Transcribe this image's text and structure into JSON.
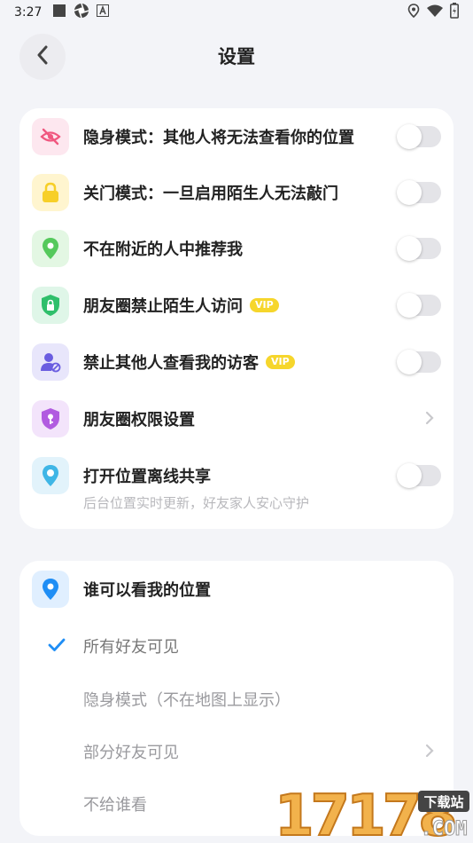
{
  "status_bar": {
    "time": "3:27"
  },
  "header": {
    "title": "设置"
  },
  "privacy": {
    "items": [
      {
        "label": "隐身模式：其他人将无法查看你的位置",
        "icon": "eye-off-icon",
        "icon_bg": "#fde7ef",
        "icon_color": "#f0577f",
        "control": "toggle",
        "on": false
      },
      {
        "label": "关门模式：一旦启用陌生人无法敲门",
        "icon": "lock-icon",
        "icon_bg": "#fff5cf",
        "icon_color": "#f7cf28",
        "control": "toggle",
        "on": false
      },
      {
        "label": "不在附近的人中推荐我",
        "icon": "location-pin-icon",
        "icon_bg": "#e3f7e3",
        "icon_color": "#55c95c",
        "control": "toggle",
        "on": false
      },
      {
        "label": "朋友圈禁止陌生人访问",
        "icon": "shield-lock-icon",
        "icon_bg": "#dff6e8",
        "icon_color": "#2fbf6b",
        "control": "toggle",
        "on": false,
        "badge": "VIP"
      },
      {
        "label": "禁止其他人查看我的访客",
        "icon": "user-block-icon",
        "icon_bg": "#e8e6fb",
        "icon_color": "#6a5de0",
        "control": "toggle",
        "on": false,
        "badge": "VIP"
      },
      {
        "label": "朋友圈权限设置",
        "icon": "shield-key-icon",
        "icon_bg": "#f3e4fb",
        "icon_color": "#b15be0",
        "control": "chevron"
      },
      {
        "label": "打开位置离线共享",
        "icon": "location-share-icon",
        "icon_bg": "#e2f3fb",
        "icon_color": "#3fb6e6",
        "control": "toggle",
        "on": false
      }
    ],
    "offline_share_note": "后台位置实时更新，好友家人安心守护"
  },
  "visibility": {
    "title": "谁可以看我的位置",
    "icon": "location-pin-icon",
    "icon_bg": "#e0efff",
    "icon_color": "#1f8ef5",
    "options": [
      {
        "label": "所有好友可见",
        "selected": true
      },
      {
        "label": "隐身模式（不在地图上显示）",
        "selected": false
      },
      {
        "label": "部分好友可见",
        "selected": false,
        "chevron": true
      },
      {
        "label": "不给谁看",
        "selected": false
      }
    ]
  },
  "watermark": {
    "number": "17178",
    "badge": "下载站",
    "domain": ".COM"
  }
}
